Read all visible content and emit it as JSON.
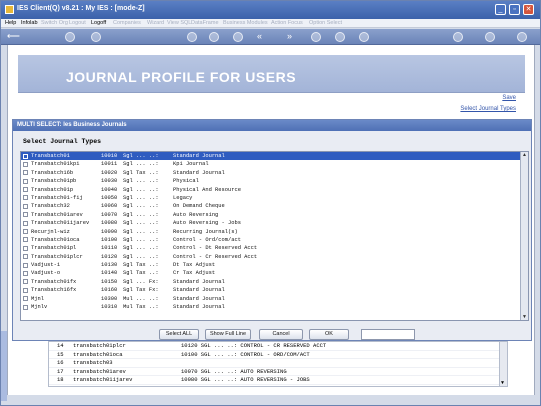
{
  "window": {
    "title": "IES Client(Q) v8.21 : My IES :       [mode-Z]"
  },
  "menu": {
    "items": [
      "Help",
      "Infolab",
      "Switch Org",
      "Logout",
      "Logoff",
      "Companies",
      "Wizard",
      "View SQL",
      "DataFrame",
      "Business Modules",
      "Action Focus",
      "Option Select"
    ]
  },
  "page": {
    "heading": "JOURNAL PROFILE FOR USERS",
    "save_link": "Save",
    "select_link": "Select Journal Types"
  },
  "dialog": {
    "title": "MULTI SELECT: Ies Business Journals",
    "subtitle": "Select Journal Types",
    "rows": [
      {
        "code": "Transbatch01",
        "num": "10010",
        "flags": "Sgl ... ..:",
        "desc": "Standard Journal",
        "selected": true
      },
      {
        "code": "Transbatch01kpi",
        "num": "10011",
        "flags": "Sgl ... ..:",
        "desc": "Kpi Journal"
      },
      {
        "code": "Transbatch16b",
        "num": "10020",
        "flags": "Sgl Tax ..:",
        "desc": "Standard Journal"
      },
      {
        "code": "Transbatch01pb",
        "num": "10030",
        "flags": "Sgl ... ..:",
        "desc": "Physical"
      },
      {
        "code": "Transbatch01p",
        "num": "10040",
        "flags": "Sgl ... ..:",
        "desc": "Physical And Resource"
      },
      {
        "code": "Transbatch01-fij",
        "num": "10050",
        "flags": "Sgl ... ..:",
        "desc": "Legacy"
      },
      {
        "code": "Transbatch32",
        "num": "10060",
        "flags": "Sgl ... ..:",
        "desc": "On Demand Cheque"
      },
      {
        "code": "Transbatch01arev",
        "num": "10070",
        "flags": "Sgl ... ..:",
        "desc": "Auto Reversing"
      },
      {
        "code": "Transbatch01ijarev",
        "num": "10080",
        "flags": "Sgl ... ..:",
        "desc": "Auto Reversing - Jobs"
      },
      {
        "code": "Recurjnl-wiz",
        "num": "10090",
        "flags": "Sgl ... ..:",
        "desc": "Recurring Journal(s)"
      },
      {
        "code": "Transbatch01oca",
        "num": "10100",
        "flags": "Sgl ... ..:",
        "desc": "Control - Ord/com/act"
      },
      {
        "code": "Transbatch01pl",
        "num": "10110",
        "flags": "Sgl ... ..:",
        "desc": "Control - Dt Reserved Acct"
      },
      {
        "code": "Transbatch01plcr",
        "num": "10120",
        "flags": "Sgl ... ..:",
        "desc": "Control - Cr Reserved Acct"
      },
      {
        "code": "Vadjust-i",
        "num": "10130",
        "flags": "Sgl Tax ..:",
        "desc": "Dt Tax Adjust"
      },
      {
        "code": "Vadjust-o",
        "num": "10140",
        "flags": "Sgl Tax ..:",
        "desc": "Cr Tax Adjust"
      },
      {
        "code": "Transbatch01fx",
        "num": "10150",
        "flags": "Sgl ... Fx:",
        "desc": "Standard Journal"
      },
      {
        "code": "Transbatch16fx",
        "num": "10160",
        "flags": "Sgl Tax Fx:",
        "desc": "Standard Journal"
      },
      {
        "code": "Mjnl",
        "num": "10300",
        "flags": "Mul ... ..:",
        "desc": "Standard Journal"
      },
      {
        "code": "Mjnlv",
        "num": "10310",
        "flags": "Mul Tax ..:",
        "desc": "Standard Journal"
      }
    ],
    "buttons": {
      "select_all": "Select ALL",
      "show_full_line": "Show Full Line",
      "cancel": "Cancel",
      "ok": "OK"
    }
  },
  "background_list": {
    "rows": [
      {
        "num": "14",
        "code": "transbatch01plcr",
        "desc": "10120 SGL ... ..: CONTROL - CR RESERVED ACCT"
      },
      {
        "num": "15",
        "code": "transbatch01oca",
        "desc": "10100 SGL ... ..: CONTROL - ORD/COM/ACT"
      },
      {
        "num": "16",
        "code": "transbatch03",
        "desc": ""
      },
      {
        "num": "17",
        "code": "transbatch01arev",
        "desc": "10070 SGL ... ..: AUTO REVERSING"
      },
      {
        "num": "18",
        "code": "transbatch01ijarev",
        "desc": "10080 SGL ... ..: AUTO REVERSING - JOBS"
      }
    ]
  },
  "colors": {
    "selection": "#2f5cc0",
    "titlebar": "#3b61aa",
    "banner": "#a3b4d8"
  }
}
